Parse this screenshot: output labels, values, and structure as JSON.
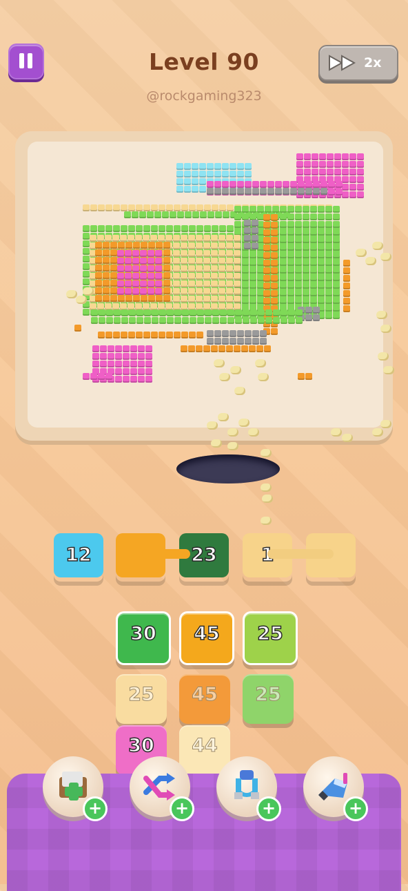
{
  "header": {
    "level_title": "Level 90",
    "username": "@rockgaming323",
    "speed_label": "2x"
  },
  "slots": [
    {
      "value": "12",
      "color": "#4cc9ee"
    },
    {
      "value": "",
      "color": "#f5a623"
    },
    {
      "value": "23",
      "color": "#2f7a3e"
    },
    {
      "value": "1",
      "color": "#f7d38a"
    },
    {
      "value": "",
      "color": "#f7d38a"
    }
  ],
  "piles": {
    "row1": [
      {
        "value": "30",
        "color": "#3fb84d"
      },
      {
        "value": "45",
        "color": "#f4a81c"
      },
      {
        "value": "25",
        "color": "#9ed24a"
      }
    ],
    "row2": [
      {
        "value": "25",
        "color": "#f9dca0"
      },
      {
        "value": "45",
        "color": "#f39a3a"
      },
      {
        "value": "25",
        "color": "#8fd46a"
      }
    ],
    "row3": [
      {
        "value": "30",
        "color": "#ef6ec7"
      },
      {
        "value": "44",
        "color": "#fbe7b6"
      }
    ]
  },
  "boosters": [
    {
      "name": "add-slot"
    },
    {
      "name": "shuffle"
    },
    {
      "name": "magnet"
    },
    {
      "name": "vacuum"
    }
  ],
  "colors": {
    "pink": "#ef5fc6",
    "green": "#7fd957",
    "orange": "#f39a2a",
    "cream": "#f7d892",
    "gray": "#9a9a9a",
    "cyan": "#8fe3f2"
  }
}
